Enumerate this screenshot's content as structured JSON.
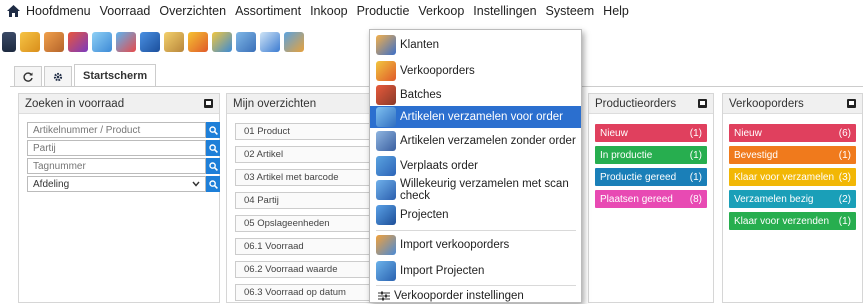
{
  "menubar": {
    "items": [
      "Hoofdmenu",
      "Voorraad",
      "Overzichten",
      "Assortiment",
      "Inkoop",
      "Productie",
      "Verkoop",
      "Instellingen",
      "Systeem",
      "Help"
    ]
  },
  "tabs": {
    "refresh_icon": "refresh-icon",
    "settings_icon": "gear-icon",
    "start_label": "Startscherm"
  },
  "search_panel": {
    "title": "Zoeken in voorraad",
    "article_placeholder": "Artikelnummer / Product",
    "batch_placeholder": "Partij",
    "tag_placeholder": "Tagnummer",
    "department_value": "Afdeling"
  },
  "overview_panel": {
    "title": "Mijn overzichten",
    "items": [
      "01 Product",
      "02 Artikel",
      "03 Artikel met barcode",
      "04 Partij",
      "05 Opslageenheden",
      "06.1 Voorraad",
      "06.2 Voorraad waarde",
      "06.3 Voorraad op datum"
    ]
  },
  "production_panel": {
    "title": "Productieorders",
    "badges": [
      {
        "label": "Nieuw",
        "count": "(1)",
        "color": "#e0405e"
      },
      {
        "label": "In productie",
        "count": "(1)",
        "color": "#27ae4f"
      },
      {
        "label": "Productie gereed",
        "count": "(1)",
        "color": "#1a7fb8"
      },
      {
        "label": "Plaatsen gereed",
        "count": "(8)",
        "color": "#e84ab3"
      }
    ]
  },
  "sales_panel": {
    "title": "Verkooporders",
    "badges": [
      {
        "label": "Nieuw",
        "count": "(6)",
        "color": "#e0405e"
      },
      {
        "label": "Bevestigd",
        "count": "(1)",
        "color": "#f07a1c"
      },
      {
        "label": "Klaar voor verzamelen",
        "count": "(3)",
        "color": "#f2b705"
      },
      {
        "label": "Verzamelen bezig",
        "count": "(2)",
        "color": "#1a9fb8"
      },
      {
        "label": "Klaar voor verzenden",
        "count": "(1)",
        "color": "#27ae4f"
      }
    ]
  },
  "dropdown": {
    "items": [
      {
        "label": "Klanten",
        "icon": "customers-icon"
      },
      {
        "label": "Verkooporders",
        "icon": "sales-orders-icon"
      },
      {
        "label": "Batches",
        "icon": "batches-icon"
      },
      {
        "label": "Artikelen verzamelen voor order",
        "icon": "collect-order-icon"
      },
      {
        "label": "Artikelen verzamelen zonder order",
        "icon": "collect-no-order-icon"
      },
      {
        "label": "Verplaats order",
        "icon": "move-order-icon"
      },
      {
        "label": "Willekeurig verzamelen met scan check",
        "icon": "scan-check-icon"
      },
      {
        "label": "Projecten",
        "icon": "projects-icon"
      },
      {
        "label": "Import verkooporders",
        "icon": "import-sales-icon"
      },
      {
        "label": "Import Projecten",
        "icon": "import-projects-icon"
      },
      {
        "label": "Verkooporder instellingen",
        "icon": "settings-sliders-icon"
      }
    ],
    "highlighted": "Artikelen verzamelen voor order",
    "highlight_color": "#2b6fcf"
  },
  "colors": {
    "search_button": "#1e7fd8"
  }
}
